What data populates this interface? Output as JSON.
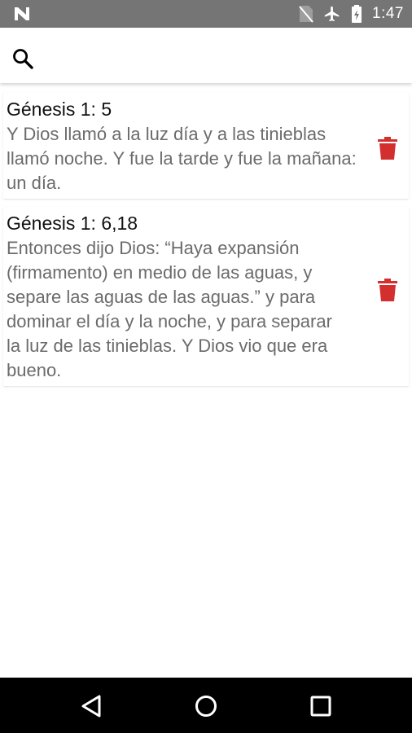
{
  "status_bar": {
    "time": "1:47",
    "icons": [
      "n-logo-icon",
      "no-sim-icon",
      "airplane-icon",
      "battery-charging-icon"
    ]
  },
  "search": {
    "icon": "search-icon",
    "placeholder": "",
    "value": ""
  },
  "verses": [
    {
      "reference": "Génesis 1: 5",
      "lines": [
        "Y Dios llamó a la luz día y a las tinieblas",
        "llamó noche. Y fue la tarde y fue la mañana:",
        "un día."
      ],
      "delete_icon": "trash-icon"
    },
    {
      "reference": "Génesis 1: 6,18",
      "lines": [
        "Entonces dijo Dios: “Haya expansión",
        "(firmamento) en medio de las aguas, y",
        "separe las aguas de las aguas.” y para",
        "dominar el día y la noche, y para separar",
        "la luz de las tinieblas. Y Dios vio que era",
        "bueno."
      ],
      "delete_icon": "trash-icon"
    }
  ],
  "nav_bar": {
    "icons": [
      "back-icon",
      "home-icon",
      "recents-icon"
    ]
  },
  "colors": {
    "status_bar": "#757575",
    "delete": "#d32f2f",
    "verse_text": "#6b6b6b",
    "nav_bar": "#000000"
  }
}
